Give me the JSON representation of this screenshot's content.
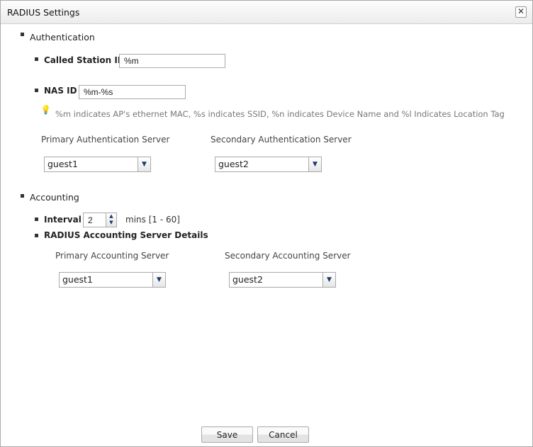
{
  "dialog": {
    "title": "RADIUS Settings",
    "close_icon": "close-icon"
  },
  "authentication": {
    "heading": "Authentication",
    "called_station_id": {
      "label": "Called Station ID",
      "value": "%m"
    },
    "nas_id": {
      "label": "NAS ID",
      "value": "%m-%s"
    },
    "hint": "%m indicates AP's ethernet MAC, %s indicates SSID, %n indicates Device Name and %l Indicates Location Tag",
    "primary": {
      "label": "Primary Authentication Server",
      "value": "guest1"
    },
    "secondary": {
      "label": "Secondary Authentication Server",
      "value": "guest2"
    }
  },
  "accounting": {
    "heading": "Accounting",
    "interval": {
      "label": "Interval",
      "value": "2",
      "unit": "mins [1 - 60]"
    },
    "details_heading": "RADIUS Accounting Server Details",
    "primary": {
      "label": "Primary Accounting Server",
      "value": "guest1"
    },
    "secondary": {
      "label": "Secondary Accounting Server",
      "value": "guest2"
    }
  },
  "buttons": {
    "save": "Save",
    "cancel": "Cancel"
  }
}
